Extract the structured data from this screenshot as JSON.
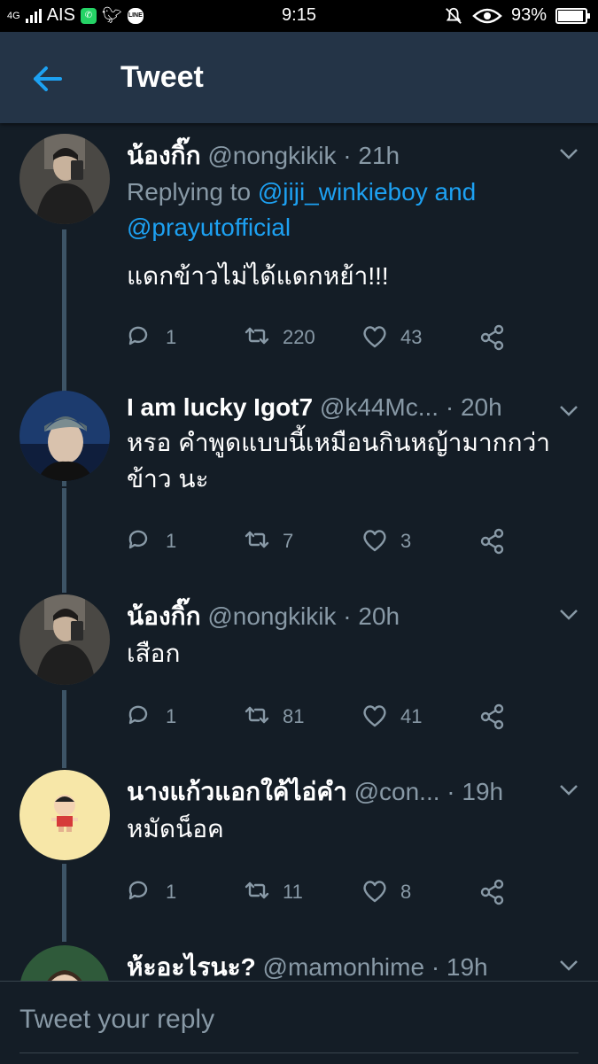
{
  "status_bar": {
    "signal_label": "4G",
    "carrier": "AIS",
    "time": "9:15",
    "battery": "93%",
    "battery_level": 0.93,
    "icons": [
      "whatsapp-icon",
      "twitter-icon",
      "line-icon",
      "bell-muted-icon",
      "eye-icon",
      "battery-icon"
    ]
  },
  "app_bar": {
    "title": "Tweet"
  },
  "tweets": [
    {
      "name": "น้องกิ๊ก",
      "handle": "@nongkikik",
      "time": "· 21h",
      "replying_prefix": "Replying to",
      "replying_link1": "@jiji_winkieboy",
      "replying_and": "and",
      "replying_link2": "@prayutofficial",
      "body": "แดกข้าวไม่ได้แดกหย้า!!!",
      "replies": "1",
      "retweets": "220",
      "likes": "43"
    },
    {
      "name": "I am lucky Igot7",
      "handle": "@k44Mc...",
      "time": "· 20h",
      "body": "หรอ คำพูดแบบนี้เหมือนกินหญ้ามากกว่าข้าว นะ",
      "replies": "1",
      "retweets": "7",
      "likes": "3"
    },
    {
      "name": "น้องกิ๊ก",
      "handle": "@nongkikik",
      "time": "· 20h",
      "body": "เสือก",
      "replies": "1",
      "retweets": "81",
      "likes": "41"
    },
    {
      "name": "นางแก้วแอกใค้ไอ่คำ",
      "handle": "@con...",
      "time": "· 19h",
      "body": "หมัดน็อค",
      "replies": "1",
      "retweets": "11",
      "likes": "8"
    },
    {
      "name": "ห้ะอะไรนะ?",
      "handle": "@mamonhime",
      "time": "· 19h"
    }
  ],
  "composer": {
    "placeholder": "Tweet your reply"
  },
  "colors": {
    "background": "#141d26",
    "app_bar": "#243447",
    "accent": "#1da1f2",
    "muted": "#8899a6"
  }
}
